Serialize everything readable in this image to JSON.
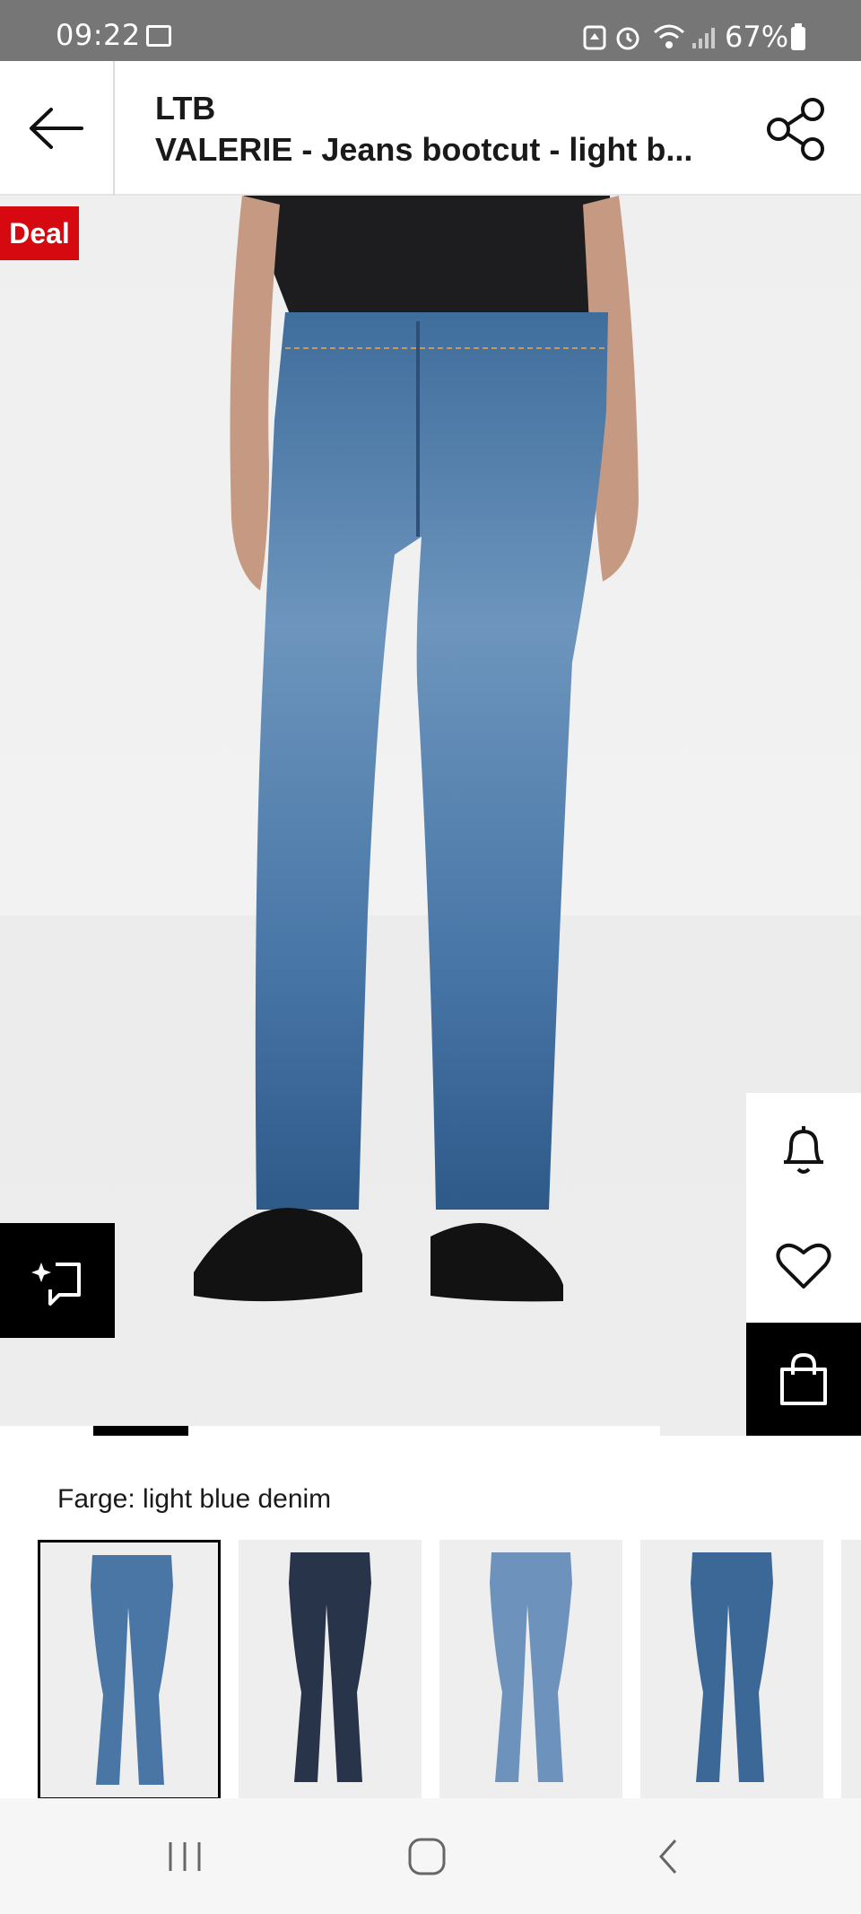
{
  "status_bar": {
    "time": "09:22",
    "battery": "67%"
  },
  "header": {
    "brand": "LTB",
    "title": "VALERIE - Jeans bootcut - light b..."
  },
  "hero": {
    "badge": "Deal",
    "gallery_progress": 0.14
  },
  "color": {
    "label": "Farge: light blue denim",
    "selected_index": 0
  },
  "swatches": [
    {
      "name": "light blue denim",
      "denim": "#4a76a5",
      "selected": true
    },
    {
      "name": "dark denim",
      "denim": "#283449",
      "selected": false
    },
    {
      "name": "light denim",
      "denim": "#6d93bd",
      "selected": false
    },
    {
      "name": "blue denim",
      "denim": "#3b6896",
      "selected": false
    }
  ],
  "colors": {
    "deal_red": "#d70910",
    "status_bar_gray": "#767676"
  },
  "icons": [
    "back-arrow-icon",
    "share-icon",
    "bell-icon",
    "heart-icon",
    "shopping-bag-icon",
    "ai-sparkle-icon",
    "nav-recents-icon",
    "nav-home-icon",
    "nav-back-icon"
  ]
}
